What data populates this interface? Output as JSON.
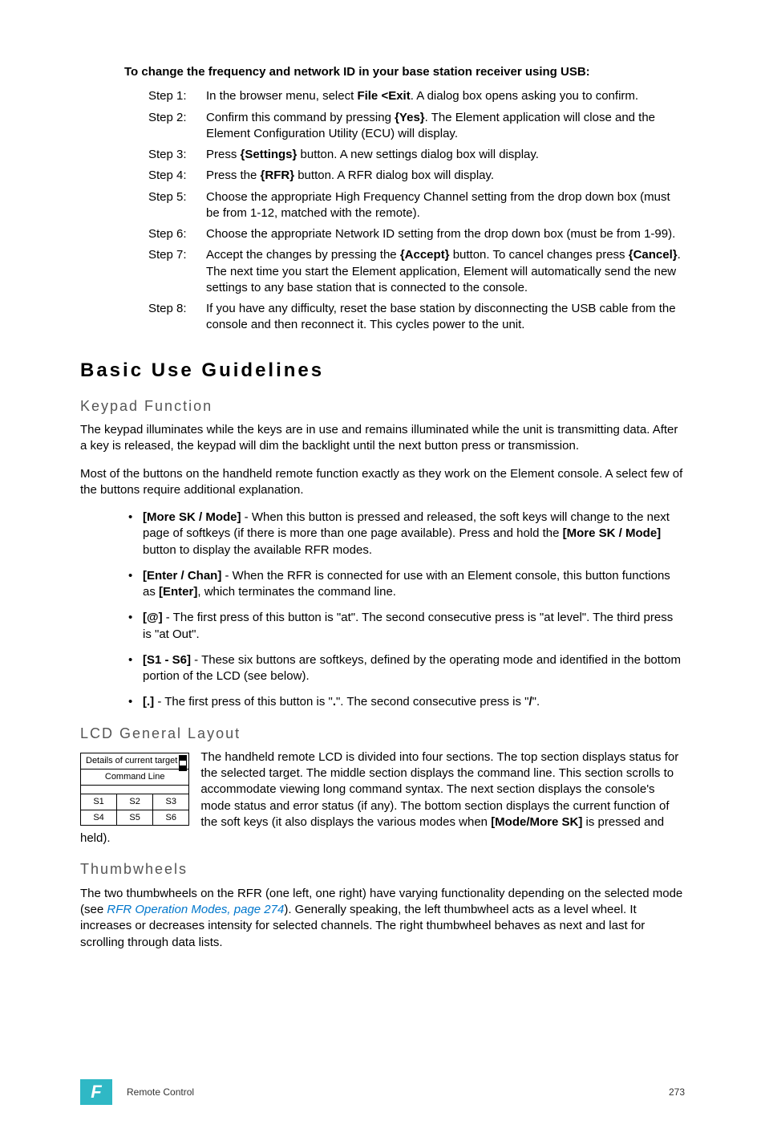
{
  "intro": "To change the frequency and network ID in your base station receiver using USB:",
  "steps": [
    {
      "label": "Step 1:",
      "pre": "In the browser menu, select ",
      "b1": "File <Exit",
      "post": ". A dialog box opens asking you to confirm."
    },
    {
      "label": "Step 2:",
      "pre": "Confirm this command by pressing ",
      "b1": "{Yes}",
      "post": ". The Element application will close and the Element Configuration Utility (ECU) will display."
    },
    {
      "label": "Step 3:",
      "pre": "Press ",
      "b1": "{Settings}",
      "post": " button. A new settings dialog box will display."
    },
    {
      "label": "Step 4:",
      "pre": "Press the ",
      "b1": "{RFR}",
      "post": " button. A RFR dialog box will display."
    },
    {
      "label": "Step 5:",
      "pre": "Choose the appropriate High Frequency Channel setting from the drop down box (must be from 1-12, matched with the remote).",
      "b1": "",
      "post": ""
    },
    {
      "label": "Step 6:",
      "pre": "Choose the appropriate Network ID setting from the drop down box (must be from 1-99).",
      "b1": "",
      "post": ""
    },
    {
      "label": "Step 7:",
      "pre": "Accept the changes by pressing the ",
      "b1": "{Accept}",
      "mid": " button. To cancel changes press ",
      "b2": "{Cancel}",
      "post": ". The next time you start the Element application, Element will automatically send the new settings to any base station that is connected to the console."
    },
    {
      "label": "Step 8:",
      "pre": "If you have any difficulty, reset the base station by disconnecting the USB cable from the console and then reconnect it. This cycles power to the unit.",
      "b1": "",
      "post": ""
    }
  ],
  "h1": "Basic Use Guidelines",
  "keypad": {
    "title": "Keypad Function",
    "p1": "The keypad illuminates while the keys are in use and remains illuminated while the unit is transmitting data. After a key is released, the keypad will dim the backlight until the next button press or transmission.",
    "p2": "Most of the buttons on the handheld remote function exactly as they work on the Element console. A select few of the buttons require additional explanation."
  },
  "bullets": [
    {
      "b1": "[More SK / Mode]",
      "t1": " - When this button is pressed and released, the soft keys will change to the next page of softkeys (if there is more than one page available). Press and hold the ",
      "b2": "[More SK / Mode]",
      "t2": " button to display the available RFR modes."
    },
    {
      "b1": "[Enter / Chan]",
      "t1": " - When the RFR is connected for use with an Element console, this button functions as ",
      "b2": "[Enter]",
      "t2": ", which terminates the command line."
    },
    {
      "b1": "[@]",
      "t1": " - The first press of this button is \"at\". The second consecutive press is \"at level\". The third press is \"at Out\".",
      "b2": "",
      "t2": ""
    },
    {
      "b1": "[S1 - S6]",
      "t1": " - These six buttons are softkeys, defined by the operating mode and identified in the bottom portion of the LCD (see below).",
      "b2": "",
      "t2": ""
    },
    {
      "b1": "[.]",
      "t1": " - The first press of this button is \"",
      "b2": ".",
      "t2": "\". The second consecutive press is \"",
      "b3": "/",
      "t3": "\"."
    }
  ],
  "lcd": {
    "title": "LCD General Layout",
    "diagram": {
      "r1": "Details of current target",
      "r2": "Command Line",
      "s": [
        "S1",
        "S2",
        "S3",
        "S4",
        "S5",
        "S6"
      ]
    },
    "p_pre": "The handheld remote LCD is divided into four sections. The top section displays status for the selected target. The middle section displays the command line. This section scrolls to accommodate viewing long command syntax. The next section displays the console's mode status and error status (if any). The bottom section displays the current function of the soft keys (it also displays the various modes when ",
    "p_b": "[Mode/More SK]",
    "p_post": " is pressed and held)."
  },
  "thumb": {
    "title": "Thumbwheels",
    "p_pre": "The two thumbwheels on the RFR (one left, one right) have varying functionality depending on the selected mode (see ",
    "link": "RFR Operation Modes, page 274",
    "p_post": "). Generally speaking, the left thumbwheel acts as a level wheel. It increases or decreases intensity for selected channels. The right thumbwheel behaves as next and last for scrolling through data lists."
  },
  "footer": {
    "tab": "F",
    "label": "Remote Control",
    "page": "273"
  }
}
